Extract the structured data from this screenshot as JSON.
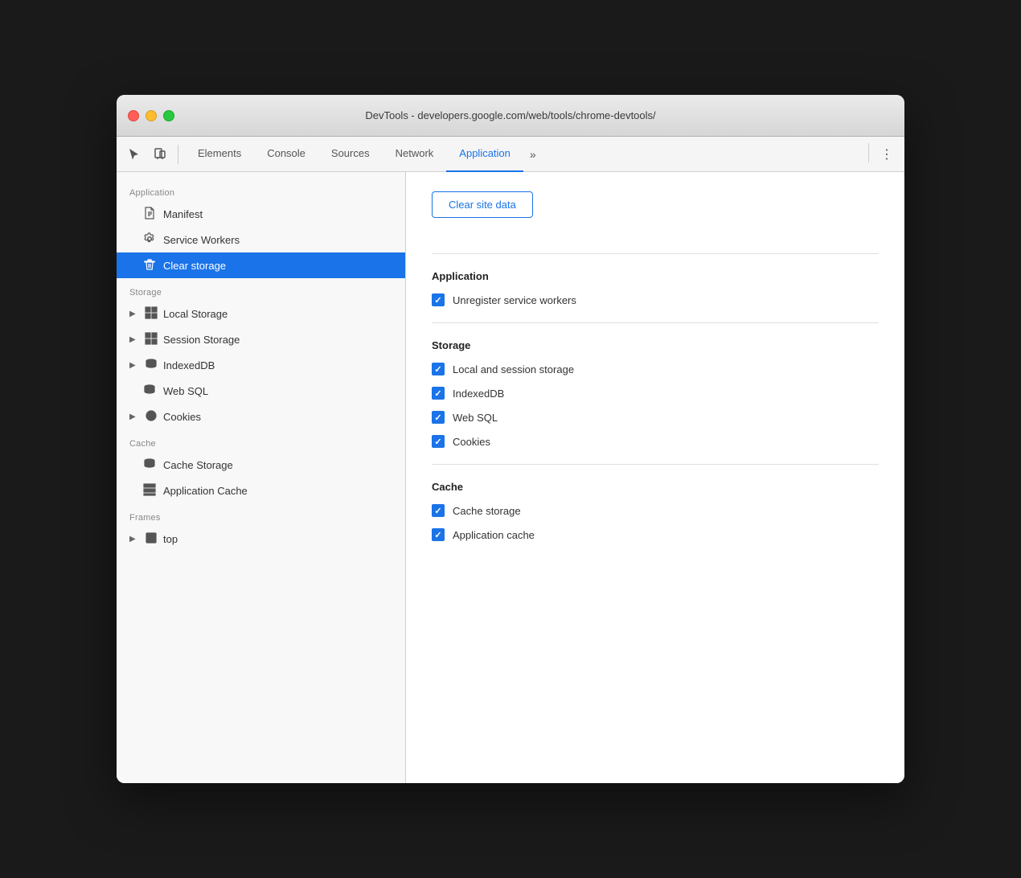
{
  "window": {
    "title": "DevTools - developers.google.com/web/tools/chrome-devtools/"
  },
  "toolbar": {
    "tabs": [
      {
        "id": "elements",
        "label": "Elements",
        "active": false
      },
      {
        "id": "console",
        "label": "Console",
        "active": false
      },
      {
        "id": "sources",
        "label": "Sources",
        "active": false
      },
      {
        "id": "network",
        "label": "Network",
        "active": false
      },
      {
        "id": "application",
        "label": "Application",
        "active": true
      }
    ],
    "more_label": "»",
    "menu_icon": "⋮"
  },
  "sidebar": {
    "sections": [
      {
        "id": "application",
        "label": "Application",
        "items": [
          {
            "id": "manifest",
            "label": "Manifest",
            "icon": "file",
            "expandable": false,
            "active": false
          },
          {
            "id": "service-workers",
            "label": "Service Workers",
            "icon": "gear",
            "expandable": false,
            "active": false
          },
          {
            "id": "clear-storage",
            "label": "Clear storage",
            "icon": "trash",
            "expandable": false,
            "active": true
          }
        ]
      },
      {
        "id": "storage",
        "label": "Storage",
        "items": [
          {
            "id": "local-storage",
            "label": "Local Storage",
            "icon": "grid",
            "expandable": true,
            "active": false
          },
          {
            "id": "session-storage",
            "label": "Session Storage",
            "icon": "grid",
            "expandable": true,
            "active": false
          },
          {
            "id": "indexeddb",
            "label": "IndexedDB",
            "icon": "database",
            "expandable": true,
            "active": false
          },
          {
            "id": "web-sql",
            "label": "Web SQL",
            "icon": "database",
            "expandable": false,
            "active": false
          },
          {
            "id": "cookies",
            "label": "Cookies",
            "icon": "cookie",
            "expandable": true,
            "active": false
          }
        ]
      },
      {
        "id": "cache",
        "label": "Cache",
        "items": [
          {
            "id": "cache-storage",
            "label": "Cache Storage",
            "icon": "stack",
            "expandable": false,
            "active": false
          },
          {
            "id": "application-cache",
            "label": "Application Cache",
            "icon": "grid",
            "expandable": false,
            "active": false
          }
        ]
      },
      {
        "id": "frames",
        "label": "Frames",
        "items": [
          {
            "id": "top",
            "label": "top",
            "icon": "frame",
            "expandable": true,
            "active": false
          }
        ]
      }
    ]
  },
  "main": {
    "clear_button": "Clear site data",
    "sections": [
      {
        "id": "application",
        "title": "Application",
        "checkboxes": [
          {
            "id": "unregister-sw",
            "label": "Unregister service workers",
            "checked": true
          }
        ]
      },
      {
        "id": "storage",
        "title": "Storage",
        "checkboxes": [
          {
            "id": "local-session",
            "label": "Local and session storage",
            "checked": true
          },
          {
            "id": "indexeddb",
            "label": "IndexedDB",
            "checked": true
          },
          {
            "id": "web-sql",
            "label": "Web SQL",
            "checked": true
          },
          {
            "id": "cookies",
            "label": "Cookies",
            "checked": true
          }
        ]
      },
      {
        "id": "cache",
        "title": "Cache",
        "checkboxes": [
          {
            "id": "cache-storage",
            "label": "Cache storage",
            "checked": true
          },
          {
            "id": "application-cache",
            "label": "Application cache",
            "checked": true
          }
        ]
      }
    ]
  }
}
